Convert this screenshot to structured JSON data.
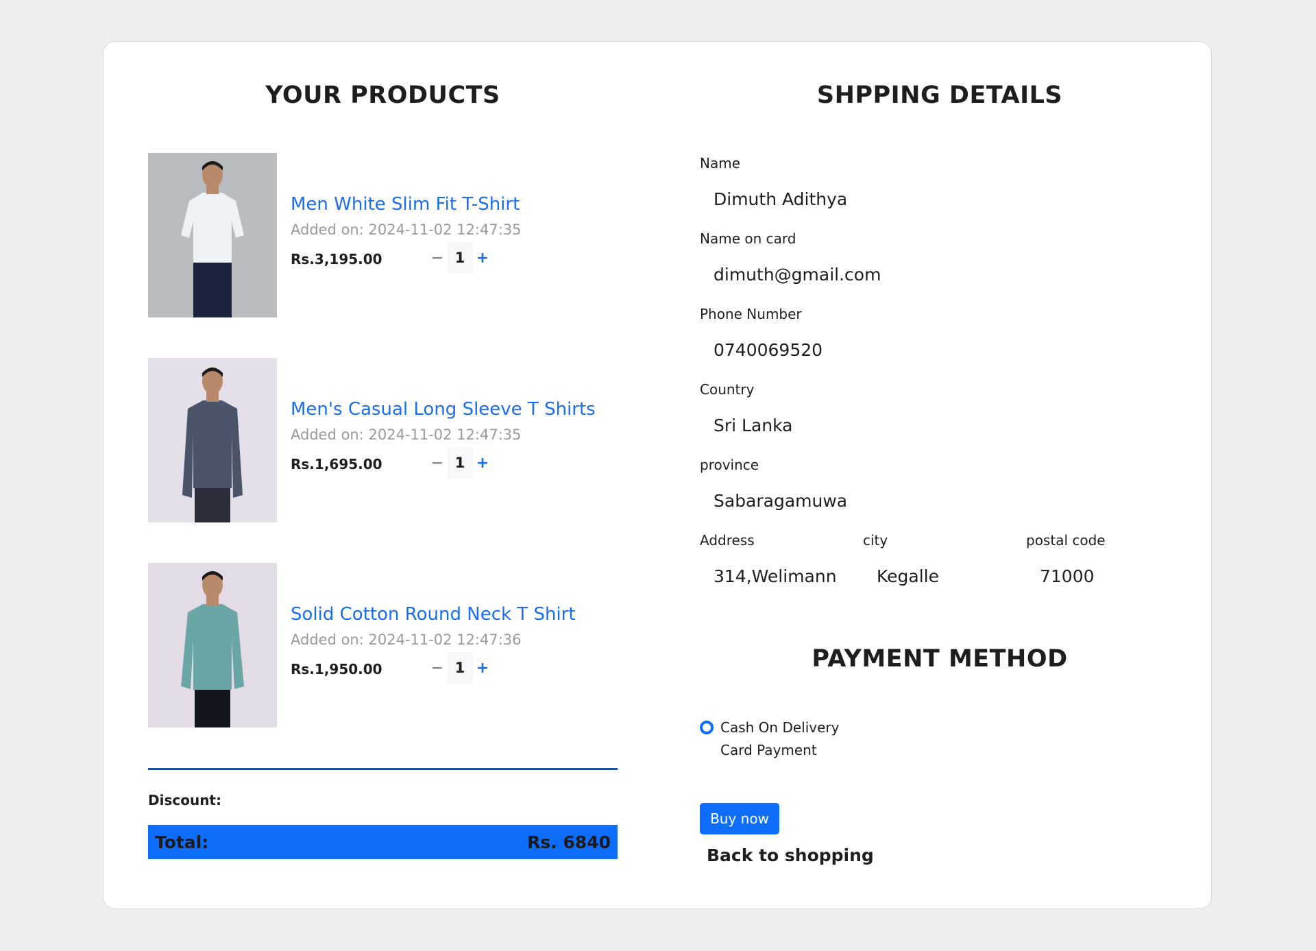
{
  "products_section": {
    "title": "YOUR PRODUCTS",
    "items": [
      {
        "name": "Men White Slim Fit T-Shirt",
        "added": "Added on: 2024-11-02 12:47:35",
        "price": "Rs.3,195.00",
        "qty": "1",
        "minus": "−",
        "plus": "+",
        "shirt_color": "#eef1f6",
        "bg_color": "#b9bdc0"
      },
      {
        "name": "Men's Casual Long Sleeve T Shirts",
        "added": "Added on: 2024-11-02 12:47:35",
        "price": "Rs.1,695.00",
        "qty": "1",
        "minus": "−",
        "plus": "+",
        "shirt_color": "#4a5468",
        "bg_color": "#e4dfe9"
      },
      {
        "name": "Solid Cotton Round Neck T Shirt",
        "added": "Added on: 2024-11-02 12:47:36",
        "price": "Rs.1,950.00",
        "qty": "1",
        "minus": "−",
        "plus": "+",
        "shirt_color": "#6aa6a6",
        "bg_color": "#e3dbe6"
      }
    ],
    "discount_label": "Discount:",
    "total_label": "Total:",
    "total_value": "Rs. 6840"
  },
  "shipping": {
    "title": "SHPPING DETAILS",
    "name_label": "Name",
    "name_value": "Dimuth Adithya",
    "card_label": "Name on card",
    "card_value": "dimuth@gmail.com",
    "phone_label": "Phone Number",
    "phone_value": "0740069520",
    "country_label": "Country",
    "country_value": "Sri Lanka",
    "province_label": "province",
    "province_value": "Sabaragamuwa",
    "address_label": "Address",
    "address_value": "314,Welimann",
    "city_label": "city",
    "city_value": "Kegalle",
    "postal_label": "postal code",
    "postal_value": "71000"
  },
  "payment": {
    "title": "PAYMENT METHOD",
    "option_cod": "Cash On Delivery",
    "option_card": "Card Payment",
    "buy_label": "Buy now",
    "back_label": "Back to shopping"
  },
  "colors": {
    "accent": "#0d6efd",
    "link": "#1a6df0",
    "divider": "#1f4fa0"
  }
}
